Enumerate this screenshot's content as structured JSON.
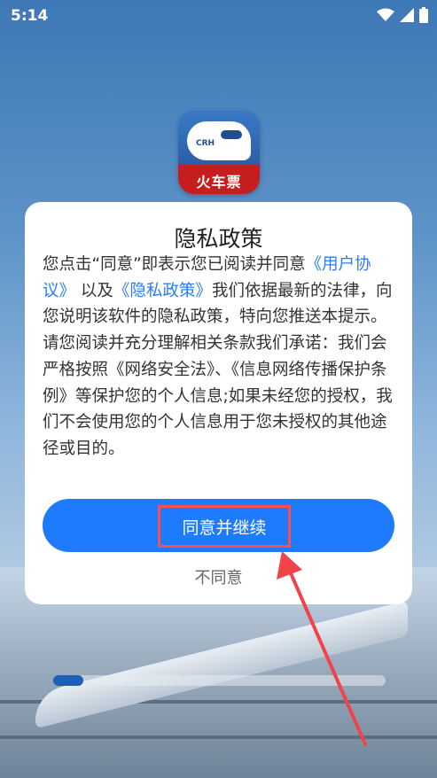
{
  "status_bar": {
    "time": "5:14",
    "icons": [
      "wifi-icon",
      "signal-icon",
      "battery-icon"
    ]
  },
  "app": {
    "icon_train_text": "CRH",
    "label": "火车票"
  },
  "dialog": {
    "title": "隐私政策",
    "body": {
      "part1": "您点击“同意”即表示您已阅读并同意",
      "link_user_agreement": "《用户协议》",
      "part2": "以及",
      "link_privacy_policy": "《隐私政策》",
      "part3": "我们依据最新的法律，向您说明该软件的隐私政策，特向您推送本提示。请您阅读并充分理解相关条款我们承诺：我们会严格按照《网络安全法》、《信息网络传播保护条例》等保护您的个人信息;如果未经您的授权，我们不会使用您的个人信息用于您未授权的其他途径或目的。"
    },
    "agree_button": "同意并继续",
    "disagree_button": "不同意"
  },
  "loading": {
    "progress": 0.09
  },
  "colors": {
    "primary": "#1f7bfd",
    "link": "#2e7cf6",
    "highlight": "#ff4d4f"
  }
}
